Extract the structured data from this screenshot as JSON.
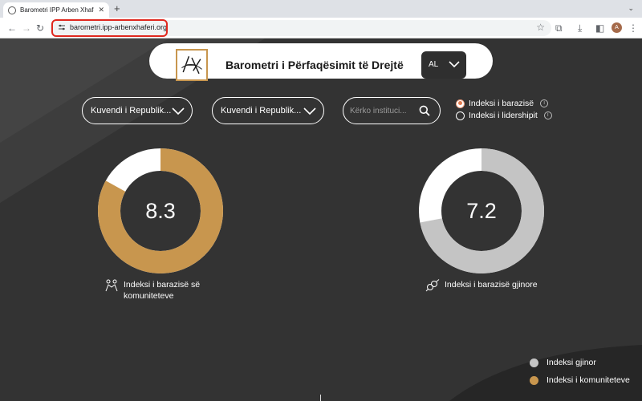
{
  "browser": {
    "tab_title": "Barometri IPP Arben Xhaferi",
    "url": "barometri.ipp-arbenxhaferi.org",
    "avatar_letter": "A"
  },
  "header": {
    "title": "Barometri i Përfaqësimit të Drejtë",
    "language": "AL"
  },
  "filters": {
    "select1": "Kuvendi i Republik...",
    "select2": "Kuvendi i Republik...",
    "search_placeholder": "Kërko instituci..."
  },
  "index_options": [
    {
      "label": "Indeksi i barazisë",
      "selected": true
    },
    {
      "label": "Indeksi i lidershipit",
      "selected": false
    }
  ],
  "rings": [
    {
      "value": "8.3",
      "fraction": 0.83,
      "color": "#c8964e",
      "label_line1": "Indeksi i barazisë së",
      "label_line2": "komuniteteve",
      "icon": "handshake-icon"
    },
    {
      "value": "7.2",
      "fraction": 0.72,
      "color": "#c4c4c4",
      "label_line1": "Indeksi i barazisë gjinore",
      "label_line2": "",
      "icon": "gender-icon"
    }
  ],
  "legend": [
    {
      "label": "Indeksi gjinor",
      "color": "#c4c4c4"
    },
    {
      "label": "Indeksi i komuniteteve",
      "color": "#c8964e"
    }
  ]
}
